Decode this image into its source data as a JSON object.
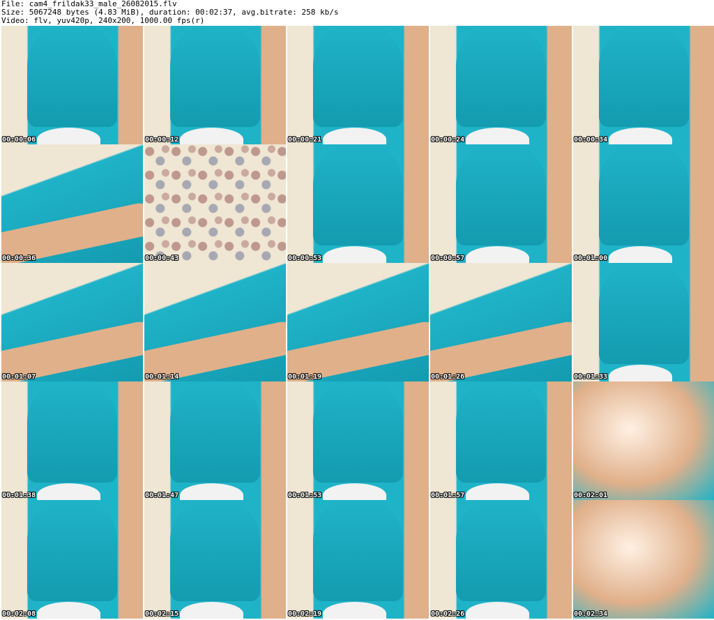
{
  "meta": {
    "file_line": "File: cam4_frildak33_male_26082015.flv",
    "size_line": "Size: 5067248 bytes (4.83 MiB), duration: 00:02:37, avg.bitrate: 258 kb/s",
    "video_line": "Video: flv, yuv420p, 240x200, 1000.00 fps(r)"
  },
  "colors": {
    "shirt": "#1fb3c8",
    "shirt_dark": "#149bb0",
    "skin": "#e0b08a",
    "fabric": "#efe6d3",
    "white_cloth": "#f2f2f2"
  },
  "thumbnails": [
    {
      "time": "00:00:06",
      "variant": "shirt"
    },
    {
      "time": "00:00:12",
      "variant": "shirt"
    },
    {
      "time": "00:00:21",
      "variant": "shirt"
    },
    {
      "time": "00:00:24",
      "variant": "shirt"
    },
    {
      "time": "00:00:34",
      "variant": "shirt"
    },
    {
      "time": "00:00:36",
      "variant": "arm"
    },
    {
      "time": "00:00:43",
      "variant": "fabric"
    },
    {
      "time": "00:00:53",
      "variant": "shirt"
    },
    {
      "time": "00:00:57",
      "variant": "shirt"
    },
    {
      "time": "00:01:00",
      "variant": "shirt"
    },
    {
      "time": "00:01:07",
      "variant": "arm"
    },
    {
      "time": "00:01:14",
      "variant": "arm"
    },
    {
      "time": "00:01:19",
      "variant": "arm"
    },
    {
      "time": "00:01:26",
      "variant": "arm"
    },
    {
      "time": "00:01:33",
      "variant": "shirt"
    },
    {
      "time": "00:01:38",
      "variant": "shirt"
    },
    {
      "time": "00:01:47",
      "variant": "shirt"
    },
    {
      "time": "00:01:53",
      "variant": "shirt"
    },
    {
      "time": "00:01:57",
      "variant": "shirt"
    },
    {
      "time": "00:02:01",
      "variant": "blur"
    },
    {
      "time": "00:02:08",
      "variant": "shirt"
    },
    {
      "time": "00:02:15",
      "variant": "shirt"
    },
    {
      "time": "00:02:19",
      "variant": "shirt"
    },
    {
      "time": "00:02:26",
      "variant": "shirt"
    },
    {
      "time": "00:02:34",
      "variant": "blur"
    }
  ]
}
